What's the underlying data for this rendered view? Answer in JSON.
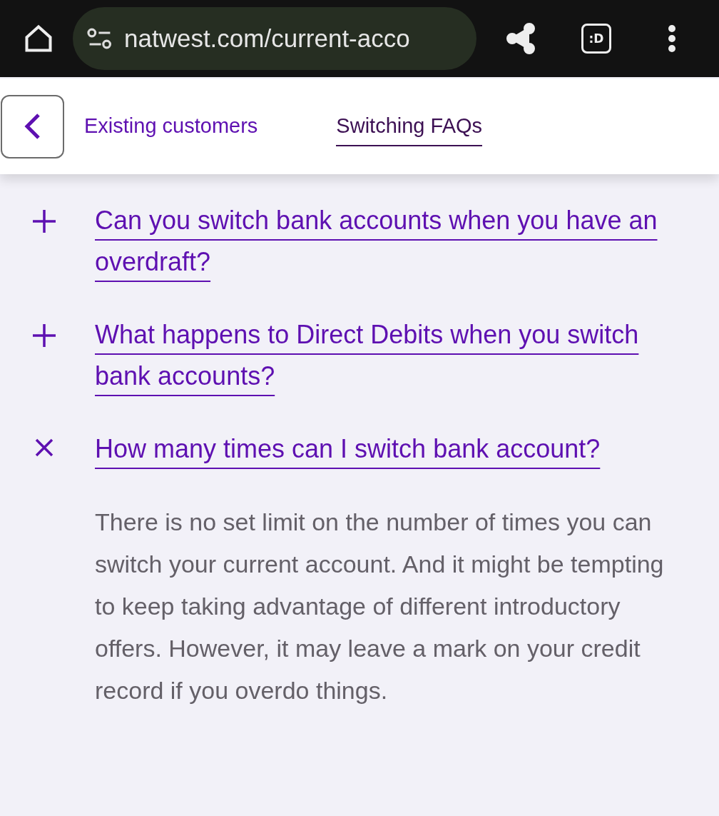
{
  "browser": {
    "url": "natwest.com/current-acco",
    "tab_switcher_label": ":D"
  },
  "nav": {
    "links": [
      {
        "label": "Existing customers",
        "selected": false
      },
      {
        "label": "Switching FAQs",
        "selected": true
      }
    ]
  },
  "faqs": [
    {
      "question": "Can you switch bank accounts when you have an overdraft?",
      "expanded": false
    },
    {
      "question": "What happens to Direct Debits when you switch bank accounts?",
      "expanded": false
    },
    {
      "question": "How many times can I switch bank account?",
      "expanded": true,
      "answer": "There is no set limit on the number of times you can switch your current account. And it might be tempting to keep taking advantage of different introductory offers. However, it may leave a mark on your credit record if you overdo things."
    }
  ]
}
